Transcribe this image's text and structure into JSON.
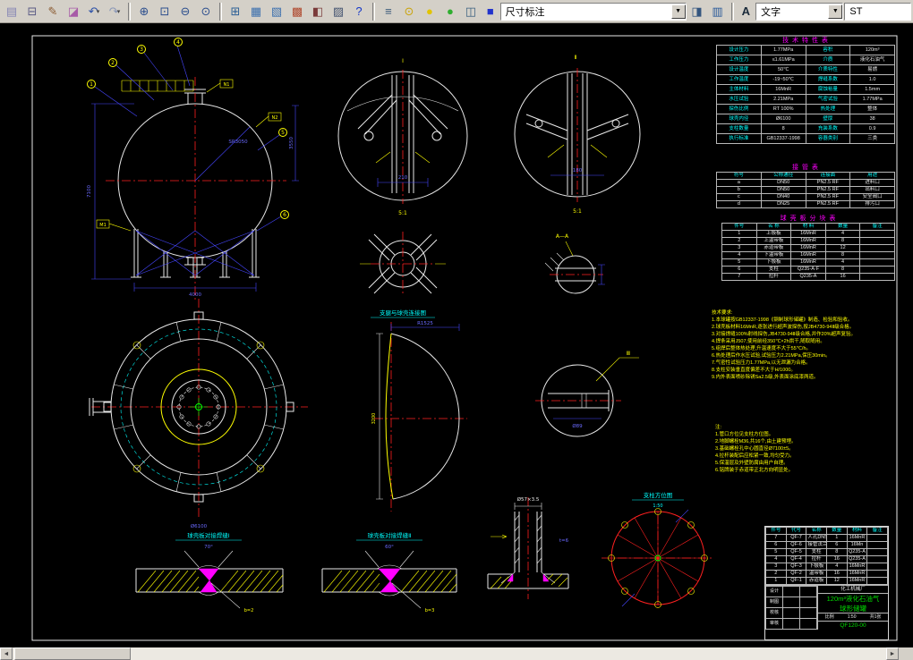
{
  "colors": {
    "canvas_background": "#000000",
    "line_white": "#e8e8e8",
    "dimension_blue": "#4646ff",
    "centerline_red": "#ff2020",
    "annotation_yellow": "#ffff00",
    "caption_cyan": "#00ffff",
    "weld_magenta": "#ff00ff",
    "title_green": "#00dd00",
    "table_title_magenta": "#ff00ff",
    "toolbar_gray": "#d4d0c8"
  },
  "toolbar": {
    "dd_glyph": "▾",
    "groups": {
      "g1": [
        {
          "name": "sheet-icon",
          "glyph": "▤",
          "color": "#8585b5"
        },
        {
          "name": "print-preview-icon",
          "glyph": "⊟",
          "color": "#5a5a85"
        },
        {
          "name": "pencil-icon",
          "glyph": "✎",
          "color": "#8a5a30"
        },
        {
          "name": "erase-icon",
          "glyph": "◪",
          "color": "#a75aa7"
        },
        {
          "name": "undo-icon",
          "glyph": "↶",
          "color": "#2a50a8",
          "dd": true
        },
        {
          "name": "redo-icon",
          "glyph": "↷",
          "color": "#8b98b8",
          "dd": true
        }
      ],
      "g2": [
        {
          "name": "zoom-realtime-icon",
          "glyph": "⊕",
          "color": "#2d4f8e"
        },
        {
          "name": "zoom-window-icon",
          "glyph": "⊡",
          "color": "#2d4f8e"
        },
        {
          "name": "zoom-out-icon",
          "glyph": "⊖",
          "color": "#2d4f8e"
        },
        {
          "name": "zoom-extents-icon",
          "glyph": "⊙",
          "color": "#2d4f8e"
        }
      ],
      "g3": [
        {
          "name": "table-icon",
          "glyph": "⊞",
          "color": "#2d6096"
        },
        {
          "name": "layout-icon",
          "glyph": "▦",
          "color": "#3a6fae"
        },
        {
          "name": "sheet-set-icon",
          "glyph": "▧",
          "color": "#3a6fae"
        },
        {
          "name": "render-icon",
          "glyph": "▩",
          "color": "#b04a30"
        },
        {
          "name": "block-icon",
          "glyph": "◧",
          "color": "#7a3a3a"
        },
        {
          "name": "grid-icon",
          "glyph": "▨",
          "color": "#40506e"
        },
        {
          "name": "help-icon",
          "glyph": "?",
          "color": "#1638c8"
        }
      ],
      "g4": [
        {
          "name": "stack-icon",
          "glyph": "≡",
          "color": "#3a5a7a"
        },
        {
          "name": "bulb-icon",
          "glyph": "⊙",
          "color": "#caa40a"
        },
        {
          "name": "ball-yellow-icon",
          "glyph": "●",
          "color": "#e2c400"
        },
        {
          "name": "ball-green-icon",
          "glyph": "●",
          "color": "#2fae2f"
        },
        {
          "name": "layers-icon",
          "glyph": "◫",
          "color": "#3a6080"
        }
      ],
      "g5": [
        {
          "name": "layer-manager-icon",
          "glyph": "◨",
          "color": "#33557f"
        },
        {
          "name": "standards-icon",
          "glyph": "▥",
          "color": "#2a5a9a"
        }
      ]
    },
    "dim_combo": {
      "icon_glyph": "■",
      "icon_color": "#2233cc",
      "value": "尺寸标注",
      "arrow": "▼"
    },
    "text_combo": {
      "icon_glyph": "A",
      "icon_color": "#1a2a3a",
      "value": "文字",
      "arrow": "▼"
    },
    "right_combo": {
      "value": "ST"
    }
  },
  "scrollbar": {
    "left_glyph": "◄",
    "right_glyph": "►"
  },
  "drawing": {
    "elevation": {
      "balloons": [
        "1",
        "2",
        "3",
        "4",
        "5",
        "6"
      ],
      "tags": [
        "N1",
        "N2",
        "M1"
      ],
      "dim_left": "7100",
      "dim_bottom": "4000",
      "dim_right": "3550",
      "dim_radius": "SR3050"
    },
    "detail1": {
      "label": "Ⅰ",
      "scale": "5:1",
      "dim": "210"
    },
    "detail2": {
      "label": "Ⅱ",
      "scale": "5:1",
      "dim": "180"
    },
    "leg_plan": {
      "caption": "支腿与球壳连接图"
    },
    "section_aa": {
      "label": "A—A"
    },
    "plan": {
      "dim": "Ø6100"
    },
    "gore": {
      "dim_top": "R1525",
      "dim_left": "3200"
    },
    "detail3": {
      "label": "Ⅲ",
      "dim": "Ø89"
    },
    "nozzle": {
      "dim_top": "Ø57×3.5",
      "note": "t=6"
    },
    "weld1": {
      "caption": "球壳板对接焊缝Ⅰ",
      "angle": "70°",
      "gap": "b=2"
    },
    "weld2": {
      "caption": "球壳板对接焊缝Ⅱ",
      "angle": "60°",
      "gap": "b=3"
    },
    "orientation": {
      "caption": "支柱方位图",
      "scale": "1:50"
    }
  },
  "tables": {
    "spec": {
      "title": "技 术 特 性 表",
      "rows": [
        [
          "设计压力",
          "1.77MPa",
          "容积",
          "120m³"
        ],
        [
          "工作压力",
          "≤1.61MPa",
          "介质",
          "液化石油气"
        ],
        [
          "设计温度",
          "50℃",
          "介质特性",
          "易燃"
        ],
        [
          "工作温度",
          "-19~50℃",
          "焊缝系数",
          "1.0"
        ],
        [
          "主体材料",
          "16MnR",
          "腐蚀裕量",
          "1.5mm"
        ],
        [
          "水压试验",
          "2.21MPa",
          "气密试验",
          "1.77MPa"
        ],
        [
          "探伤比例",
          "RT 100%",
          "热处理",
          "整体"
        ],
        [
          "球壳内径",
          "Ø6100",
          "壁厚",
          "38"
        ],
        [
          "支柱数量",
          "8",
          "充装系数",
          "0.9"
        ],
        [
          "执行标准",
          "GB12337-1998",
          "容器类别",
          "三类"
        ]
      ]
    },
    "nozzles": {
      "title": "接 管 表",
      "rows": [
        [
          "符号",
          "公称通径",
          "连接面",
          "用途"
        ],
        [
          "a",
          "DN50",
          "PN2.5 RF",
          "进料口"
        ],
        [
          "b",
          "DN50",
          "PN2.5 RF",
          "出料口"
        ],
        [
          "c",
          "DN40",
          "PN2.5 RF",
          "安全阀口"
        ],
        [
          "d",
          "DN25",
          "PN2.5 RF",
          "排污口"
        ]
      ]
    },
    "plates": {
      "title": "球 壳 板 分 块 表",
      "rows": [
        [
          "件号",
          "名 称",
          "材 料",
          "数量",
          "备注"
        ],
        [
          "1",
          "上极板",
          "16MnR",
          "4",
          ""
        ],
        [
          "2",
          "上温带板",
          "16MnR",
          "8",
          ""
        ],
        [
          "3",
          "赤道带板",
          "16MnR",
          "12",
          ""
        ],
        [
          "4",
          "下温带板",
          "16MnR",
          "8",
          ""
        ],
        [
          "5",
          "下极板",
          "16MnR",
          "4",
          ""
        ],
        [
          "6",
          "支柱",
          "Q235-A·F",
          "8",
          ""
        ],
        [
          "7",
          "拉杆",
          "Q235-A",
          "16",
          ""
        ]
      ]
    }
  },
  "notes": {
    "requirements": [
      "技术要求:",
      "1.本球罐按GB12337-1998《钢制球形储罐》制造、检验和验收。",
      "2.球壳板材料16MnR,逐张进行超声波探伤,按JB4730-94Ⅱ级合格。",
      "3.对接焊缝100%射线探伤,JB4730-94Ⅱ级合格,并作20%超声复验。",
      "4.焊条采用J507,使用前经350℃×2h烘干,随取随用。",
      "5.组焊后整体热处理,升温速度不大于55℃/h。",
      "6.热处理后作水压试验,试验压力2.21MPa,保压30min。",
      "7.气密性试验压力1.77MPa,以无泄漏为合格。",
      "8.支柱安装垂直度偏差不大于H/1000。",
      "9.内外表面喷砂除锈Sa2.5级,外表面涂底漆两道。"
    ],
    "remarks": [
      "注:",
      "1.管口方位见支柱方位图。",
      "2.地脚螺栓M36,共16个,由土建预埋。",
      "3.基础螺栓孔中心圆直径Ø7100±5。",
      "4.拉杆装配后应松紧一致,均匀受力。",
      "5.保温层及外壁防腐由用户自理。",
      "6.铭牌装于赤道带正北方向明显处。"
    ]
  },
  "titleblock": {
    "bom": [
      [
        "件号",
        "代号",
        "名称",
        "数量",
        "材料",
        "备注"
      ],
      [
        "7",
        "QF-7",
        "人孔DN500",
        "1",
        "16MnR",
        ""
      ],
      [
        "6",
        "QF-6",
        "接管法兰",
        "6",
        "16Mn",
        ""
      ],
      [
        "5",
        "QF-5",
        "支柱",
        "8",
        "Q235-A",
        ""
      ],
      [
        "4",
        "QF-4",
        "拉杆",
        "16",
        "Q235-A",
        ""
      ],
      [
        "3",
        "QF-3",
        "下极板",
        "4",
        "16MnR",
        ""
      ],
      [
        "2",
        "QF-2",
        "温带板",
        "16",
        "16MnR",
        ""
      ],
      [
        "1",
        "QF-1",
        "赤道板",
        "12",
        "16MnR",
        ""
      ]
    ],
    "sign_rows": [
      [
        "设计",
        "",
        ""
      ],
      [
        "制图",
        "",
        ""
      ],
      [
        "校核",
        "",
        ""
      ],
      [
        "审核",
        "",
        ""
      ]
    ],
    "company": "化工机械厂",
    "title1": "120m³液化石油气",
    "title2": "球形储罐",
    "scale_label": "比例",
    "scale": "1:50",
    "sheet": "共1张",
    "dwgno": "QF120-00"
  }
}
